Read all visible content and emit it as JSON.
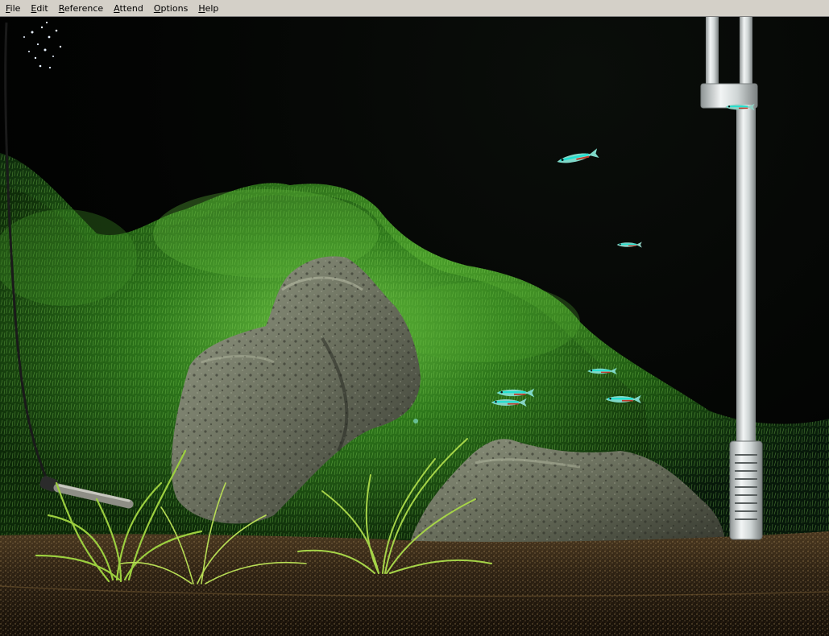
{
  "window": {
    "menu": [
      {
        "label": "File",
        "mnemonic": "F",
        "rest": "ile"
      },
      {
        "label": "Edit",
        "mnemonic": "E",
        "rest": "dit"
      },
      {
        "label": "Reference",
        "mnemonic": "R",
        "rest": "eference"
      },
      {
        "label": "Attend",
        "mnemonic": "A",
        "rest": "ttend"
      },
      {
        "label": "Options",
        "mnemonic": "O",
        "rest": "ptions"
      },
      {
        "label": "Help",
        "mnemonic": "H",
        "rest": "elp"
      }
    ]
  },
  "scene": {
    "fish_species": "neon-tetra",
    "fish_count": 7,
    "objects": [
      "air-bubbles",
      "moss-background",
      "large-rock",
      "small-rock",
      "grass-plants",
      "heater-cable",
      "filter-tube",
      "gravel-substrate"
    ],
    "colors": {
      "water": "#020302",
      "moss": "#2f7a1c",
      "moss_light": "#5fb53a",
      "rock": "#6f7462",
      "rock_dark": "#3d4036",
      "gravel": "#3a2a17",
      "fish_body": "#7fd8c8",
      "fish_stripe": "#21e0d0",
      "fish_red": "#c03a2a",
      "filter": "#c9cfcf"
    }
  }
}
